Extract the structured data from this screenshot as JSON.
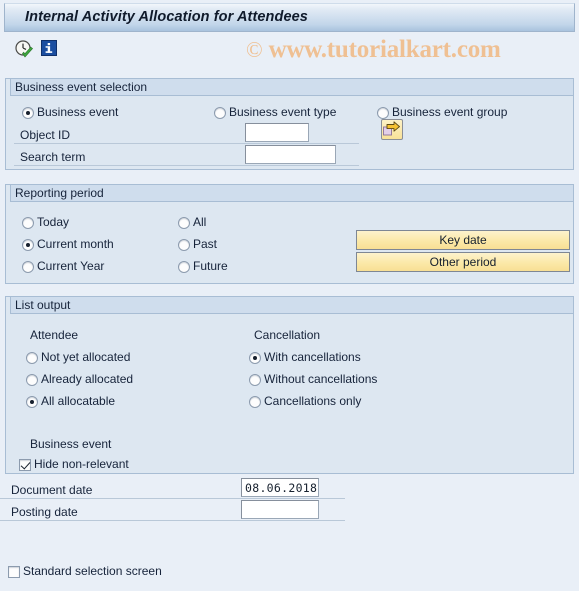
{
  "window": {
    "title": "Internal Activity Allocation for Attendees"
  },
  "toolbar": {
    "execute_icon": "clock-check-icon",
    "info_icon": "information-icon"
  },
  "watermark": {
    "copyright": "©",
    "text": "www.tutorialkart.com"
  },
  "business_event_selection": {
    "legend": "Business event selection",
    "radios": [
      {
        "label": "Business event",
        "selected": true
      },
      {
        "label": "Business event type",
        "selected": false
      },
      {
        "label": "Business event group",
        "selected": false
      }
    ],
    "fields": [
      {
        "label": "Object ID",
        "value": "",
        "placeholder": ""
      },
      {
        "label": "Search term",
        "value": "",
        "placeholder": ""
      }
    ],
    "multi_select_button": "multiple-selection-arrow-icon"
  },
  "reporting_period": {
    "legend": "Reporting period",
    "left_radios": [
      {
        "label": "Today",
        "selected": false
      },
      {
        "label": "Current month",
        "selected": true
      },
      {
        "label": "Current Year",
        "selected": false
      }
    ],
    "right_radios": [
      {
        "label": "All",
        "selected": false
      },
      {
        "label": "Past",
        "selected": false
      },
      {
        "label": "Future",
        "selected": false
      }
    ],
    "buttons": [
      {
        "label": "Key date"
      },
      {
        "label": "Other period"
      }
    ]
  },
  "list_output": {
    "legend": "List output",
    "attendee": {
      "heading": "Attendee",
      "radios": [
        {
          "label": "Not yet allocated",
          "selected": false
        },
        {
          "label": "Already allocated",
          "selected": false
        },
        {
          "label": "All allocatable",
          "selected": true
        }
      ]
    },
    "cancellation": {
      "heading": "Cancellation",
      "radios": [
        {
          "label": "With cancellations",
          "selected": true
        },
        {
          "label": "Without cancellations",
          "selected": false
        },
        {
          "label": "Cancellations only",
          "selected": false
        }
      ]
    },
    "business_event": {
      "heading": "Business event",
      "checkbox": {
        "label": "Hide non-relevant",
        "checked": true
      }
    }
  },
  "footer": {
    "document_date": {
      "label": "Document date",
      "value": "08.06.2018"
    },
    "posting_date": {
      "label": "Posting date",
      "value": ""
    },
    "standard_selection_screen": {
      "label": "Standard selection screen",
      "checked": false
    }
  },
  "colors": {
    "page_background": "#e9eff7",
    "group_background": "#dde7f1",
    "group_header": "#cfdded",
    "group_border": "#a8bdd4",
    "title_gradient_bottom": "#a9c3de",
    "button_yellow": "#fbe9a8",
    "watermark": "#efc093",
    "text": "#16233a"
  }
}
